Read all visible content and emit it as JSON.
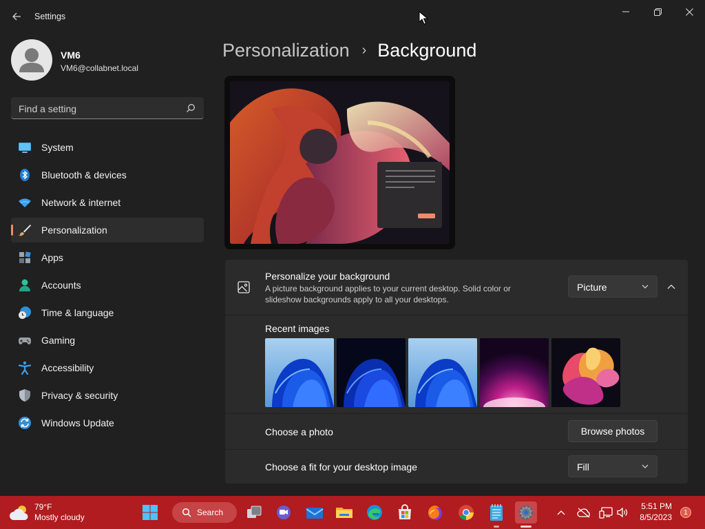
{
  "window": {
    "title": "Settings"
  },
  "user": {
    "name": "VM6",
    "email": "VM6@collabnet.local"
  },
  "search": {
    "placeholder": "Find a setting"
  },
  "sidebar": {
    "items": [
      {
        "label": "System",
        "icon": "system-icon"
      },
      {
        "label": "Bluetooth & devices",
        "icon": "bluetooth-icon"
      },
      {
        "label": "Network & internet",
        "icon": "wifi-icon"
      },
      {
        "label": "Personalization",
        "icon": "brush-icon",
        "active": true
      },
      {
        "label": "Apps",
        "icon": "apps-icon"
      },
      {
        "label": "Accounts",
        "icon": "accounts-icon"
      },
      {
        "label": "Time & language",
        "icon": "clock-globe-icon"
      },
      {
        "label": "Gaming",
        "icon": "gamepad-icon"
      },
      {
        "label": "Accessibility",
        "icon": "accessibility-icon"
      },
      {
        "label": "Privacy & security",
        "icon": "shield-icon"
      },
      {
        "label": "Windows Update",
        "icon": "update-icon"
      }
    ]
  },
  "breadcrumb": {
    "parent": "Personalization",
    "separator": "›",
    "current": "Background"
  },
  "personalize": {
    "title": "Personalize your background",
    "description": "A picture background applies to your current desktop. Solid color or slideshow backgrounds apply to all your desktops.",
    "dropdown_value": "Picture"
  },
  "recent": {
    "label": "Recent images",
    "thumbnails": [
      "bloom-blue-light",
      "bloom-blue-dark",
      "bloom-blue-light",
      "glow-purple",
      "ribbon-flower"
    ]
  },
  "choose_photo": {
    "label": "Choose a photo",
    "button": "Browse photos"
  },
  "fit": {
    "label": "Choose a fit for your desktop image",
    "dropdown_value": "Fill"
  },
  "taskbar": {
    "weather_temp": "79°F",
    "weather_condition": "Mostly cloudy",
    "search_label": "Search",
    "time": "5:51 PM",
    "date": "8/5/2023",
    "notification_count": "1",
    "color": "#b01c1f"
  },
  "colors": {
    "accent": "#f08a6a",
    "background": "#202020",
    "card": "#2b2b2b"
  }
}
